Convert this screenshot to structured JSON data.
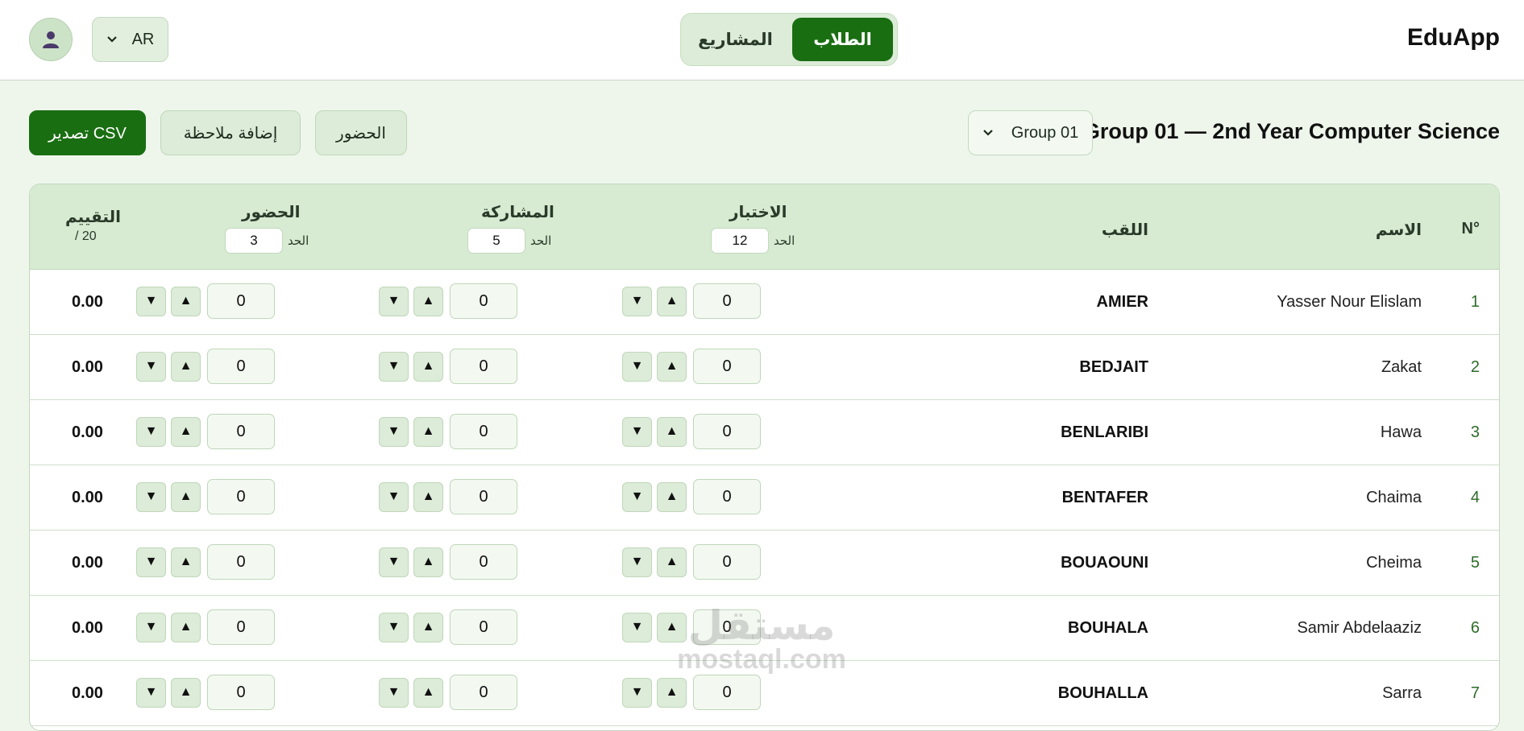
{
  "app": {
    "brand": "EduApp",
    "language": "AR"
  },
  "tabs": [
    {
      "label": "الطلاب",
      "active": true
    },
    {
      "label": "المشاريع",
      "active": false
    }
  ],
  "toolbar": {
    "group_title": "Group 01 — 2nd Year Computer Science",
    "group_select": "Group 01",
    "attendance_label": "الحضور",
    "add_note_label": "إضافة ملاحظة",
    "export_label": "تصدير CSV"
  },
  "table": {
    "headers": {
      "num": "N°",
      "name": "الاسم",
      "surname": "اللقب",
      "quiz": "الاختبار",
      "participation": "المشاركة",
      "attendance": "الحضور",
      "grade": "التقييم",
      "grade_sub": "/ 20",
      "limit_label": "الحد"
    },
    "limits": {
      "quiz": "12",
      "participation": "5",
      "attendance": "3"
    },
    "rows": [
      {
        "num": "1",
        "name": "Yasser Nour Elislam",
        "surname": "AMIER",
        "quiz": "0",
        "participation": "0",
        "attendance": "0",
        "grade": "0.00"
      },
      {
        "num": "2",
        "name": "Zakat",
        "surname": "BEDJAIT",
        "quiz": "0",
        "participation": "0",
        "attendance": "0",
        "grade": "0.00"
      },
      {
        "num": "3",
        "name": "Hawa",
        "surname": "BENLARIBI",
        "quiz": "0",
        "participation": "0",
        "attendance": "0",
        "grade": "0.00"
      },
      {
        "num": "4",
        "name": "Chaima",
        "surname": "BENTAFER",
        "quiz": "0",
        "participation": "0",
        "attendance": "0",
        "grade": "0.00"
      },
      {
        "num": "5",
        "name": "Cheima",
        "surname": "BOUAOUNI",
        "quiz": "0",
        "participation": "0",
        "attendance": "0",
        "grade": "0.00"
      },
      {
        "num": "6",
        "name": "Samir Abdelaaziz",
        "surname": "BOUHALA",
        "quiz": "0",
        "participation": "0",
        "attendance": "0",
        "grade": "0.00"
      },
      {
        "num": "7",
        "name": "Sarra",
        "surname": "BOUHALLA",
        "quiz": "0",
        "participation": "0",
        "attendance": "0",
        "grade": "0.00"
      }
    ],
    "stepper": {
      "down": "▼",
      "up": "▲"
    }
  },
  "icons": {
    "avatar": "user-icon",
    "dropdown": "chevron-down-icon"
  },
  "watermark": {
    "arabic": "مستقل",
    "latin": "mostaql.com"
  }
}
